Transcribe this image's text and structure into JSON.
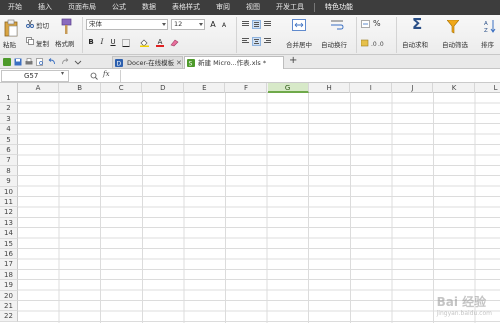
{
  "menubar": {
    "items": [
      "开始",
      "插入",
      "页面布局",
      "公式",
      "数据",
      "表格样式",
      "审阅",
      "视图",
      "开发工具",
      "特色功能"
    ]
  },
  "ribbon": {
    "paste_label": "粘贴",
    "cut_label": "剪切",
    "copy_label": "复制",
    "format_painter_label": "格式刷",
    "font_name": "宋体",
    "font_size": "12",
    "bold": "B",
    "italic": "I",
    "underline": "U",
    "font_grow": "A",
    "font_shrink": "A",
    "font_color": "A",
    "merge_center_label": "合并居中",
    "wrap_text_label": "自动换行",
    "percent_label": "%",
    "autosum_label": "自动求和",
    "autofilter_label": "自动筛选",
    "sort_label": "排序"
  },
  "tabs": [
    {
      "label": "Docer-在线模板"
    },
    {
      "label": "新建 Micro...作表.xls *"
    }
  ],
  "formula_bar": {
    "cell_ref": "G57",
    "fx_label": "fx"
  },
  "sheet": {
    "columns": [
      "A",
      "B",
      "C",
      "D",
      "E",
      "F",
      "G",
      "H",
      "I",
      "J",
      "K",
      "L"
    ],
    "selected_column": "G",
    "rows": [
      "1",
      "2",
      "3",
      "4",
      "5",
      "6",
      "7",
      "8",
      "9",
      "10",
      "11",
      "12",
      "13",
      "14",
      "15",
      "16",
      "17",
      "18",
      "19",
      "20",
      "21",
      "22"
    ]
  },
  "watermark": {
    "text": "Bai 经验",
    "sub": "jingyan.baidu.com"
  },
  "colors": {
    "menubar_bg": "#3d3d3d",
    "selected_col_bg": "#d7e9c8",
    "selected_col_border": "#6fa94a"
  }
}
